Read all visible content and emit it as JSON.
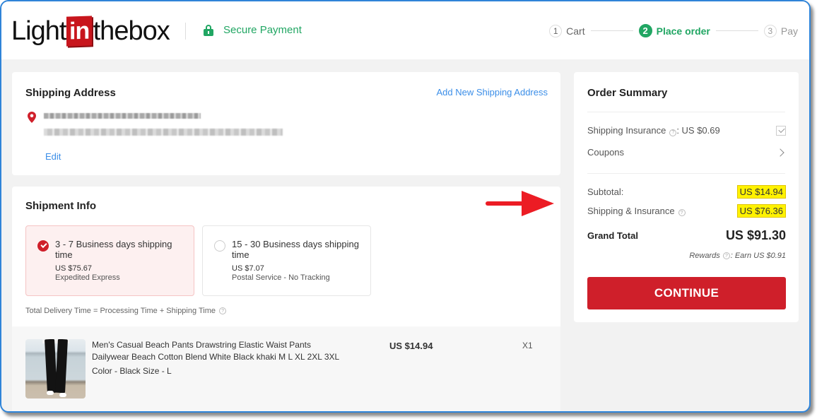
{
  "header": {
    "logo": {
      "part1": "Light",
      "part2": "in",
      "part3": "thebox"
    },
    "secure_label": "Secure Payment",
    "steps": [
      {
        "num": "1",
        "label": "Cart",
        "state": "done"
      },
      {
        "num": "2",
        "label": "Place order",
        "state": "active"
      },
      {
        "num": "3",
        "label": "Pay",
        "state": "future"
      }
    ]
  },
  "shipping_address": {
    "title": "Shipping Address",
    "add_new_label": "Add New Shipping Address",
    "edit_label": "Edit"
  },
  "shipment_info": {
    "title": "Shipment Info",
    "options": [
      {
        "title": "3 - 7 Business days shipping time",
        "price": "US $75.67",
        "method": "Expedited Express",
        "selected": true
      },
      {
        "title": "15 - 30 Business days shipping time",
        "price": "US $7.07",
        "method": "Postal Service - No Tracking",
        "selected": false
      }
    ],
    "delivery_note": "Total Delivery Time = Processing Time + Shipping Time",
    "help_icon": "?"
  },
  "product": {
    "name": "Men's Casual Beach Pants Drawstring Elastic Waist Pants Dailywear Beach Cotton Blend White Black khaki M L XL 2XL 3XL",
    "attributes": "Color - Black  Size - L",
    "price": "US $14.94",
    "quantity": "X1"
  },
  "order_summary": {
    "title": "Order Summary",
    "shipping_insurance_label": "Shipping Insurance",
    "shipping_insurance_value": ": US $0.69",
    "shipping_insurance_checked": true,
    "coupons_label": "Coupons",
    "subtotal_label": "Subtotal:",
    "subtotal_value": "US $14.94",
    "shipping_ins_label": "Shipping & Insurance",
    "shipping_ins_value": "US $76.36",
    "grand_total_label": "Grand Total",
    "grand_total_value": "US $91.30",
    "rewards_label": "Rewards",
    "rewards_value": ": Earn US $0.91",
    "continue_label": "CONTINUE"
  },
  "colors": {
    "brand_red": "#cf1f2a",
    "secure_green": "#21a663",
    "link_blue": "#3b8ee8",
    "highlight_yellow": "#fff200",
    "annotation_arrow": "#ec1c24"
  }
}
